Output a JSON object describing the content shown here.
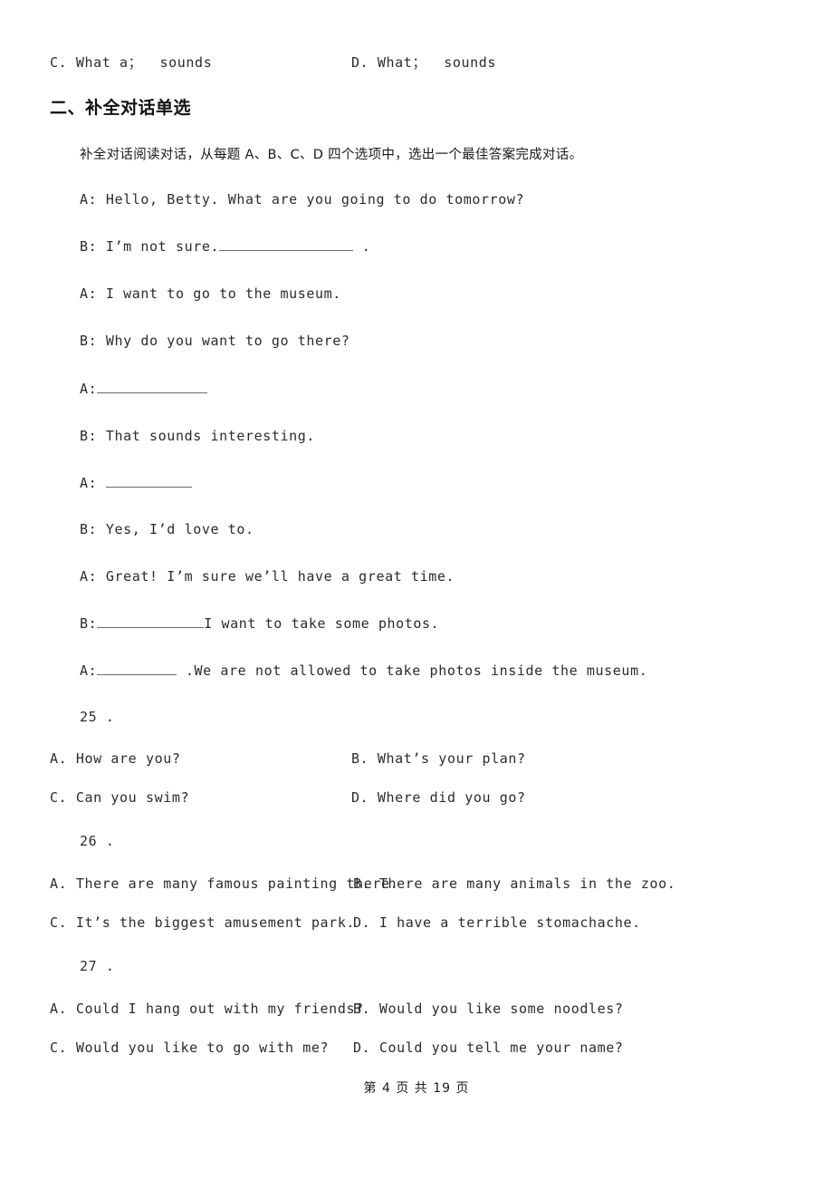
{
  "carry_over_options": {
    "option_c": "C. What a；  sounds",
    "option_d": "D. What；  sounds"
  },
  "section": {
    "heading": "二、补全对话单选",
    "instruction": "补全对话阅读对话，从每题 A、B、C、D 四个选项中，选出一个最佳答案完成对话。"
  },
  "dialogue": [
    {
      "speaker_text": "A: Hello, Betty. What are you going to do tomorrow?",
      "blank_before": "",
      "blank_after": "",
      "trailing": ""
    },
    {
      "speaker_text": "B: I’m not sure.",
      "blank_after_width": 148,
      "trailing": " ."
    },
    {
      "speaker_text": "A: I want to go to the museum.",
      "trailing": ""
    },
    {
      "speaker_text": "B: Why do you want to go there?",
      "trailing": ""
    },
    {
      "speaker_text": "A:",
      "blank_after_width": 122,
      "trailing": ""
    },
    {
      "speaker_text": "B: That sounds interesting.",
      "trailing": ""
    },
    {
      "speaker_text": "A: ",
      "blank_after_width": 95,
      "trailing": ""
    },
    {
      "speaker_text": "B: Yes, I’d love to.",
      "trailing": ""
    },
    {
      "speaker_text": "A: Great! I’m sure we’ll have a great time.",
      "trailing": ""
    },
    {
      "speaker_text": "B:",
      "blank_after_width": 118,
      "trailing": "I want to take some photos."
    },
    {
      "speaker_text": "A:",
      "blank_after_width": 88,
      "trailing": " .We are not allowed to take photos inside the museum."
    }
  ],
  "questions": [
    {
      "number": "25 .",
      "options": {
        "a": "A. How are you?",
        "b": "B. What’s your plan?",
        "c": "C. Can you swim?",
        "d": "D. Where did you go?"
      }
    },
    {
      "number": "26 .",
      "options": {
        "a": "A. There are many famous painting there.",
        "b": "B. There are many animals in the zoo.",
        "c": "C. It’s the biggest amusement park.",
        "d": "D. I have a terrible stomachache."
      }
    },
    {
      "number": "27 .",
      "options": {
        "a": "A. Could I hang out with my friends?",
        "b": "B. Would you like some noodles?",
        "c": "C. Would you like to go with me?",
        "d": "D. Could you tell me your name?"
      }
    }
  ],
  "footer": {
    "page_indicator": "第 4 页 共 19 页"
  }
}
